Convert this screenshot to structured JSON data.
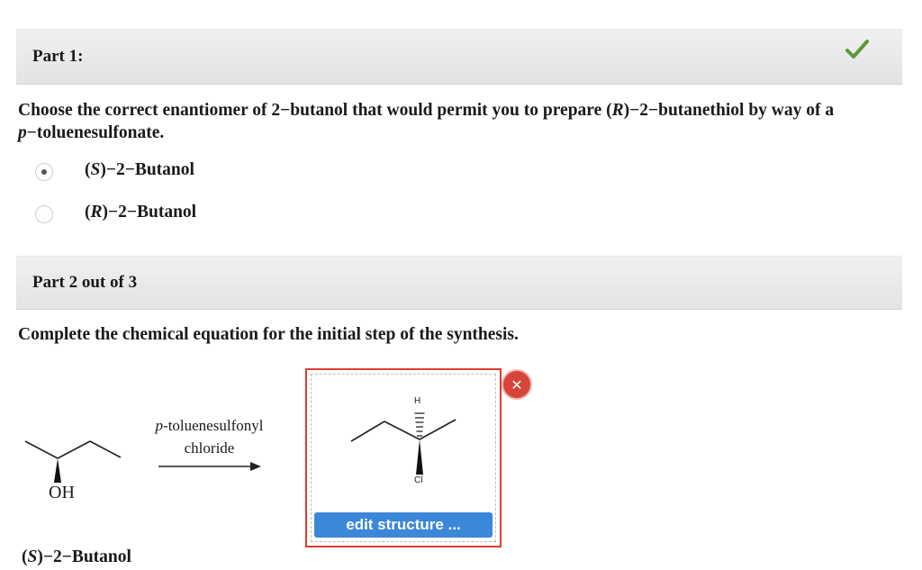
{
  "part1": {
    "title": "Part 1:",
    "question_prefix": "Choose the correct enantiomer of 2−butanol that would permit you to prepare (",
    "question_R": "R",
    "question_mid": ")−2−butanethiol by way of a ",
    "question_p": "p",
    "question_suffix": "−toluenesulfonate.",
    "options": [
      {
        "config": "S",
        "name": "−2−Butanol",
        "selected": true
      },
      {
        "config": "R",
        "name": "−2−Butanol",
        "selected": false
      }
    ],
    "status_icon": "checkmark-icon",
    "status_color": "#5b9a3a"
  },
  "part2": {
    "title": "Part 2 out of 3",
    "question": "Complete the chemical equation for the initial step of the synthesis.",
    "reactant_oh": "OH",
    "reactant_config": "S",
    "reactant_name": "−2−Butanol",
    "reagent_prefix": "p",
    "reagent_line1": "-toluenesulfonyl",
    "reagent_line2": "chloride",
    "answer_atom_top": "H",
    "answer_atom_bottom": "Cl",
    "edit_button": "edit structure ...",
    "close_icon": "close-icon",
    "close_glyph": "✕",
    "accent_color": "#3b87d8",
    "border_color": "#e03b2e"
  }
}
